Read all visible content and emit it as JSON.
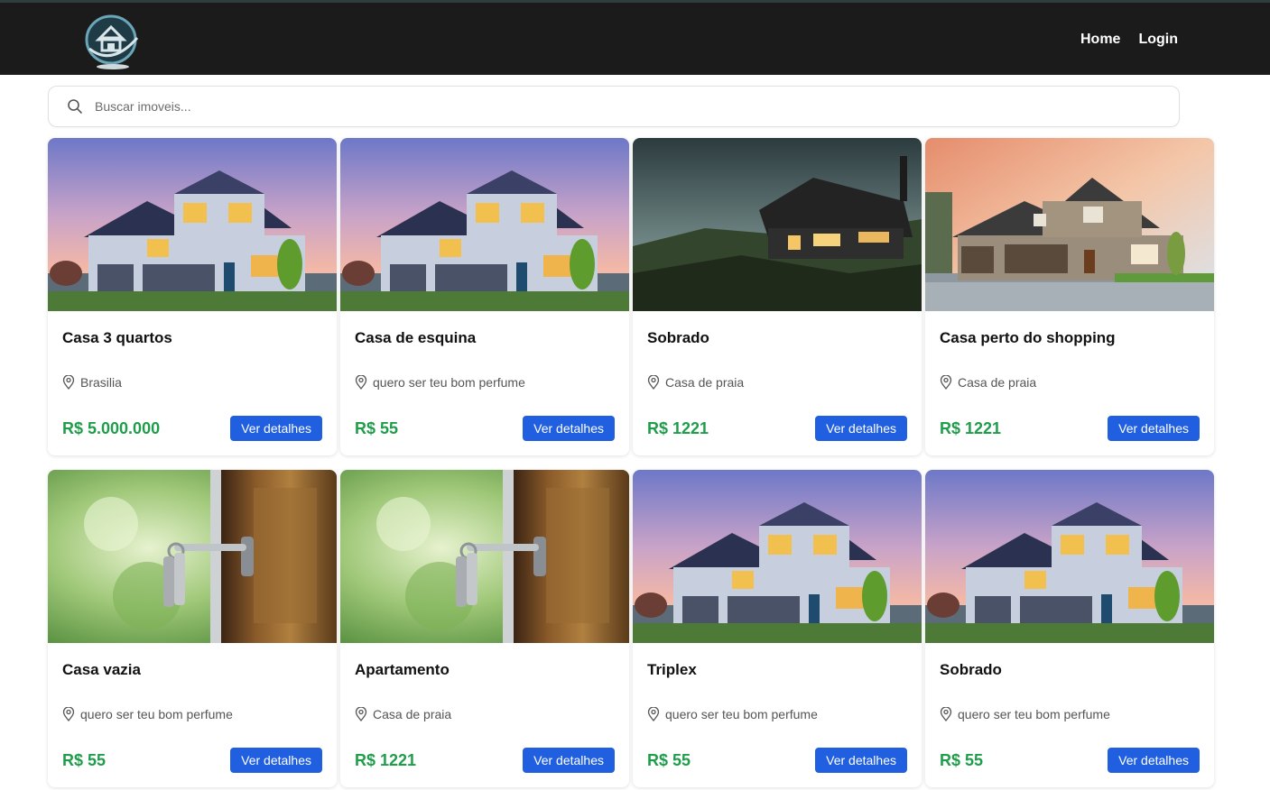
{
  "nav": {
    "home": "Home",
    "login": "Login"
  },
  "search": {
    "placeholder": "Buscar imoveis..."
  },
  "cards": [
    {
      "title": "Casa 3 quartos",
      "location": "Brasilia",
      "price": "R$ 5.000.000",
      "button": "Ver detalhes",
      "image": "house-blue-dusk"
    },
    {
      "title": "Casa de esquina",
      "location": "quero ser teu bom perfume",
      "price": "R$ 55",
      "button": "Ver detalhes",
      "image": "house-blue-dusk"
    },
    {
      "title": "Sobrado",
      "location": "Casa de praia",
      "price": "R$ 1221",
      "button": "Ver detalhes",
      "image": "house-dunes-night"
    },
    {
      "title": "Casa perto do shopping",
      "location": "Casa de praia",
      "price": "R$ 1221",
      "button": "Ver detalhes",
      "image": "house-grey-sunset"
    },
    {
      "title": "Casa vazia",
      "location": "quero ser teu bom perfume",
      "price": "R$ 55",
      "button": "Ver detalhes",
      "image": "door-keys"
    },
    {
      "title": "Apartamento",
      "location": "Casa de praia",
      "price": "R$ 1221",
      "button": "Ver detalhes",
      "image": "door-keys"
    },
    {
      "title": "Triplex",
      "location": "quero ser teu bom perfume",
      "price": "R$ 55",
      "button": "Ver detalhes",
      "image": "house-blue-dusk"
    },
    {
      "title": "Sobrado",
      "location": "quero ser teu bom perfume",
      "price": "R$ 55",
      "button": "Ver detalhes",
      "image": "house-blue-dusk"
    }
  ],
  "colors": {
    "header_bg": "#1b1b1c",
    "price": "#1f9d4b",
    "button": "#1f5fe0"
  }
}
